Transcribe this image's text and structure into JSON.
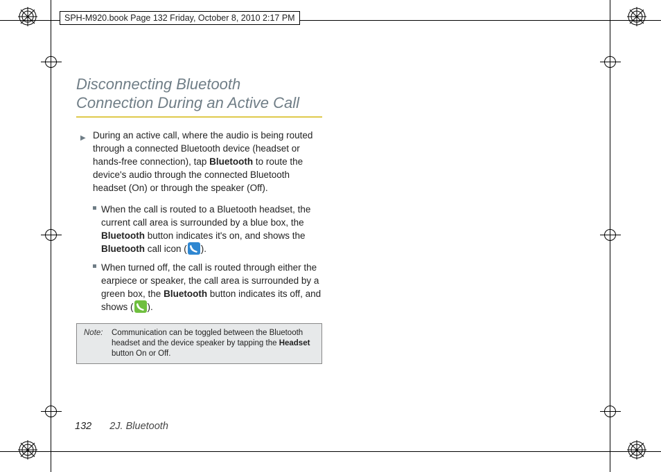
{
  "running_header": "SPH-M920.book  Page 132  Friday, October 8, 2010  2:17 PM",
  "heading_line1": "Disconnecting Bluetooth",
  "heading_line2": "Connection During an Active Call",
  "lead_a": "During an active call, where the audio is being routed through a connected Bluetooth device (headset or hands-free connection), tap ",
  "lead_bold1": "Bluetooth",
  "lead_b": " to route the device's audio through the connected Bluetooth headset (On) or through the speaker (Off).",
  "sub1_a": "When the call is routed to a Bluetooth headset, the current call area is surrounded by a blue box, the ",
  "sub1_bold1": "Bluetooth",
  "sub1_b": " button indicates it's on, and shows the ",
  "sub1_bold2": "Bluetooth",
  "sub1_c": " call icon (",
  "sub1_d": ").",
  "sub2_a": "When turned off, the call is routed through either the earpiece or speaker, the call area is surrounded by a green box, the ",
  "sub2_bold1": "Bluetooth",
  "sub2_b": " button indicates its off, and shows (",
  "sub2_c": ").",
  "note_label": "Note:",
  "note_a": "Communication can be toggled between the Bluetooth headset and the device speaker by tapping the ",
  "note_bold": "Headset",
  "note_b": " button On or Off.",
  "page_number": "132",
  "section_label": "2J. Bluetooth"
}
